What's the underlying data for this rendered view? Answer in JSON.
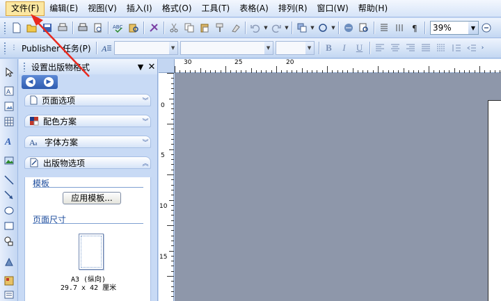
{
  "menu": {
    "items": [
      "文件(F)",
      "编辑(E)",
      "视图(V)",
      "插入(I)",
      "格式(O)",
      "工具(T)",
      "表格(A)",
      "排列(R)",
      "窗口(W)",
      "帮助(H)"
    ],
    "active_index": 0
  },
  "toolbar": {
    "zoom_value": "39%",
    "publisher_tasks_label": "Publisher 任务(P)"
  },
  "taskpane": {
    "title": "设置出版物格式",
    "sections": [
      "页面选项",
      "配色方案",
      "字体方案",
      "出版物选项"
    ],
    "template_label": "模板",
    "apply_template_button": "应用模板...",
    "page_size_label": "页面尺寸",
    "page_size_name": "A3 (纵向)",
    "page_size_dims": "29.7 x 42 厘米"
  },
  "rulers": {
    "horizontal_labels": [
      "30",
      "25",
      "20"
    ],
    "vertical_labels": [
      "0",
      "5",
      "10",
      "15"
    ]
  },
  "colors": {
    "accent": "#2f5cb0",
    "menu_highlight": "#fbe7a1",
    "workspace": "#8e97aa",
    "annotation_arrow": "#e8291f"
  }
}
